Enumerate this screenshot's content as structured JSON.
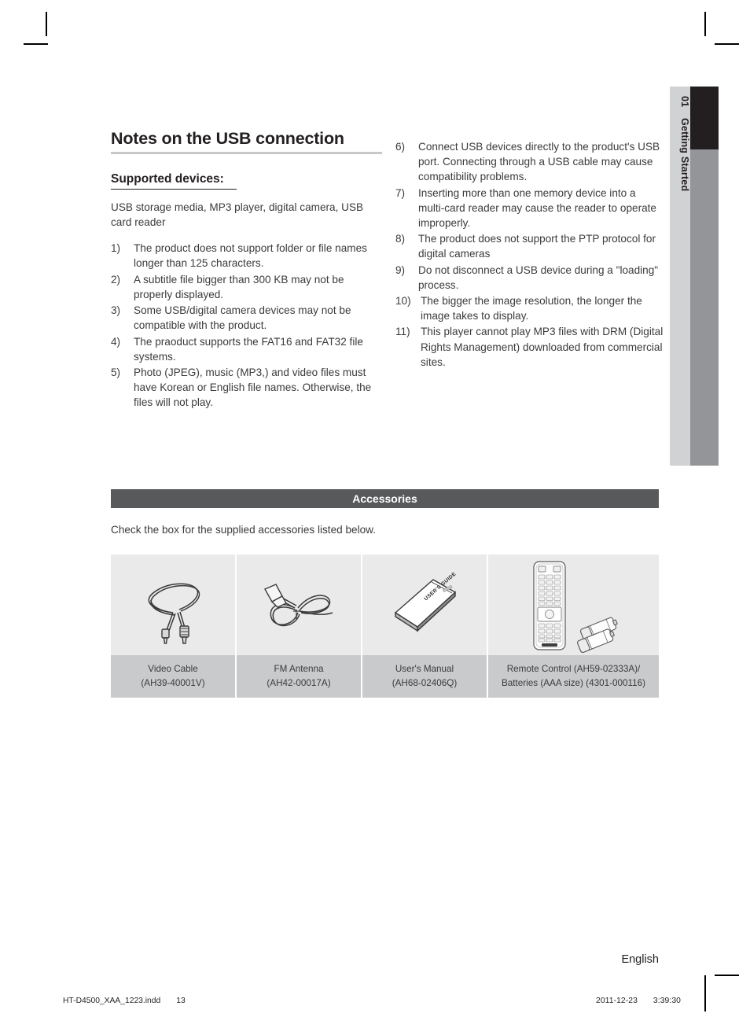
{
  "side_tab": {
    "number": "01",
    "label": "Getting Started"
  },
  "left_column": {
    "section_title": "Notes on the USB connection",
    "sub_title": "Supported devices:",
    "lead": "USB storage media, MP3 player, digital camera, USB card reader",
    "notes": [
      {
        "marker": "1)",
        "text": "The product does not support folder or file names longer than 125 characters."
      },
      {
        "marker": "2)",
        "text": "A subtitle file bigger than 300 KB may not be properly displayed."
      },
      {
        "marker": "3)",
        "text": "Some USB/digital camera devices may not be compatible with the product."
      },
      {
        "marker": "4)",
        "text": "The praoduct supports the FAT16 and FAT32 file systems."
      },
      {
        "marker": "5)",
        "text": "Photo (JPEG), music (MP3,) and video files must have Korean or English file names. Otherwise, the files will not play."
      }
    ]
  },
  "right_column": {
    "notes": [
      {
        "marker": "6)",
        "text": "Connect USB devices directly to the product's USB port. Connecting through a USB cable may cause compatibility problems."
      },
      {
        "marker": "7)",
        "text": "Inserting more than one memory device into a multi-card reader may cause the reader to operate improperly."
      },
      {
        "marker": "8)",
        "text": "The product does not support the PTP protocol for digital cameras"
      },
      {
        "marker": "9)",
        "text": "Do not disconnect a USB device during a \"loading\" process."
      },
      {
        "marker": "10)",
        "text": "The bigger the image resolution, the longer the image takes to display."
      },
      {
        "marker": "11)",
        "text": "This player cannot play MP3 files with DRM (Digital Rights Management) downloaded from commercial sites."
      }
    ]
  },
  "accessories": {
    "header": "Accessories",
    "intro": "Check the box for the supplied accessories listed below.",
    "items": [
      {
        "icon": "video-cable-icon",
        "name": "Video Cable",
        "code": "(AH39-40001V)"
      },
      {
        "icon": "fm-antenna-icon",
        "name": "FM Antenna",
        "code": "(AH42-00017A)"
      },
      {
        "icon": "users-manual-icon",
        "name": "User's Manual",
        "code": "(AH68-02406Q)"
      },
      {
        "icon": "remote-control-batteries-icon",
        "name": "Remote Control (AH59-02333A)/",
        "code": "Batteries (AAA size) (4301-000116)"
      }
    ],
    "manual_cover_text": "USER'S GUIDE"
  },
  "footer": {
    "language": "English",
    "file_name": "HT-D4500_XAA_1223.indd",
    "page_number": "13",
    "print_date": "2011-12-23",
    "print_time": "3:39:30"
  },
  "colors": {
    "accent_bar": "#58595b",
    "tab_dark": "#231f20",
    "tab_gray": "#939598",
    "cell_bg": "#eaeaea",
    "caption_bg": "#c9cacc"
  }
}
